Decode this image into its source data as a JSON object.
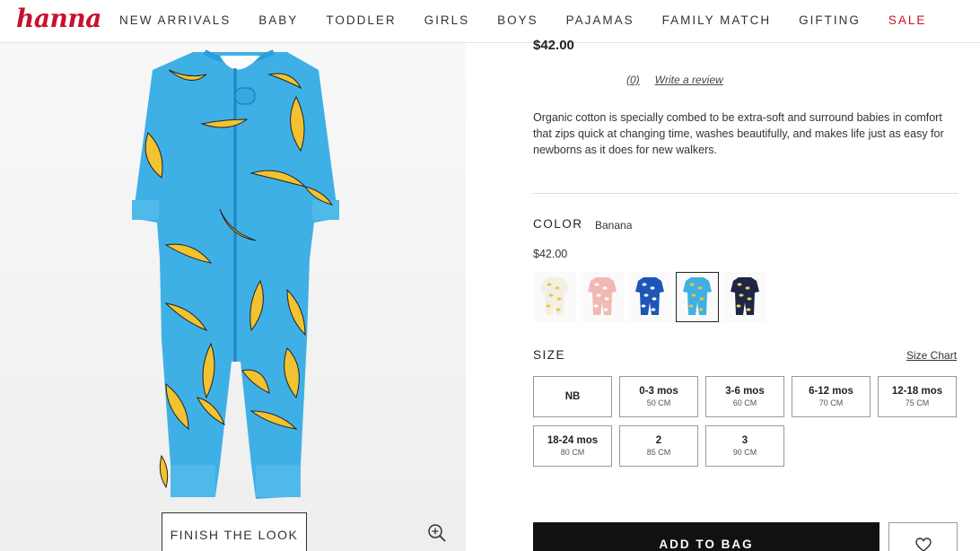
{
  "header": {
    "logo": "hanna",
    "nav": [
      "NEW ARRIVALS",
      "BABY",
      "TODDLER",
      "GIRLS",
      "BOYS",
      "PAJAMAS",
      "FAMILY MATCH",
      "GIFTING",
      "SALE"
    ]
  },
  "image_panel": {
    "finish_look_label": "FINISH THE LOOK"
  },
  "product": {
    "price": "$42.00",
    "reviews": {
      "count": "(0)",
      "write_label": "Write a review"
    },
    "description": "Organic cotton is specially combed to be extra-soft and surround babies in comfort that zips quick at changing time, washes beautifully, and makes life just as easy for newborns as it does for new walkers.",
    "color": {
      "label": "COLOR",
      "value": "Banana",
      "price": "$42.00"
    },
    "swatches": [
      {
        "name": "cream",
        "color": "#f3efe2",
        "print": "#e8c64a"
      },
      {
        "name": "pink",
        "color": "#f2b8b4",
        "print": "#ffffff"
      },
      {
        "name": "royal-blue",
        "color": "#1e56b8",
        "print": "#ffffff"
      },
      {
        "name": "banana-blue",
        "color": "#3fb0e6",
        "print": "#f2c230",
        "selected": true
      },
      {
        "name": "navy",
        "color": "#1e2545",
        "print": "#e9d36a"
      }
    ],
    "size": {
      "label": "SIZE",
      "chart_label": "Size Chart",
      "options": [
        {
          "name": "NB",
          "cm": ""
        },
        {
          "name": "0-3 mos",
          "cm": "50 CM"
        },
        {
          "name": "3-6 mos",
          "cm": "60 CM"
        },
        {
          "name": "6-12 mos",
          "cm": "70 CM"
        },
        {
          "name": "12-18 mos",
          "cm": "75 CM"
        },
        {
          "name": "18-24 mos",
          "cm": "80 CM"
        },
        {
          "name": "2",
          "cm": "85 CM"
        },
        {
          "name": "3",
          "cm": "90 CM"
        }
      ]
    },
    "add_to_bag_label": "ADD TO BAG"
  },
  "colors": {
    "brand": "#c8102e",
    "onesie": "#3fb0e6",
    "banana": "#f2c230"
  }
}
